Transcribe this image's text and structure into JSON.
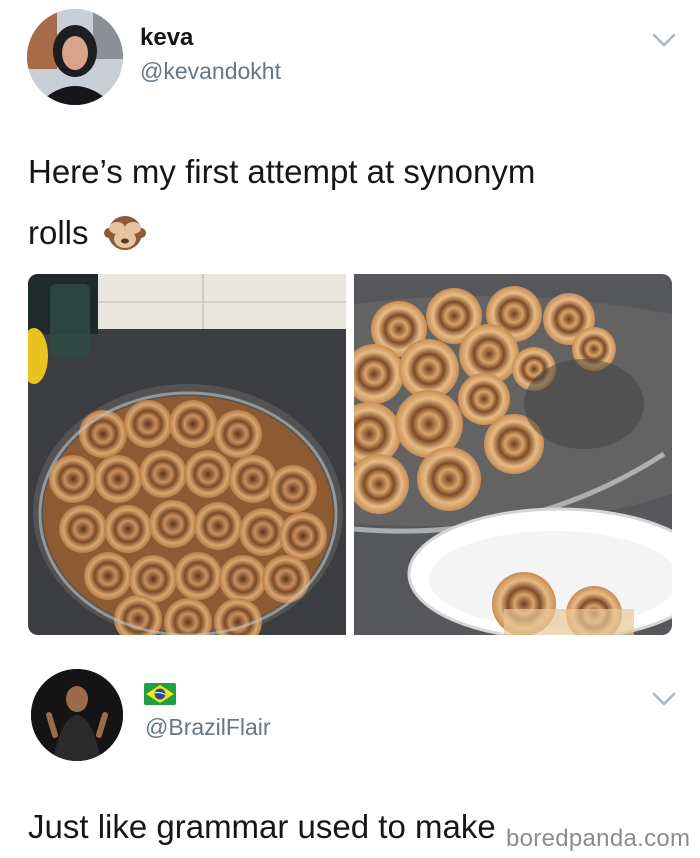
{
  "tweet": {
    "author_name": "keva",
    "author_handle": "@kevandokht",
    "text_line1": "Here’s my first attempt at synonym",
    "text_line2": "rolls",
    "emoji": "see-no-evil-monkey",
    "photos": [
      "cinnamon-rolls-full-pan-photo",
      "cinnamon-rolls-partly-eaten-photo"
    ]
  },
  "reply": {
    "author_flag": "brazil-flag",
    "author_handle": "@BrazilFlair",
    "text": "Just like grammar used to make"
  },
  "watermark": "boredpanda.com",
  "colors": {
    "text": "#14171a",
    "secondary": "#657786",
    "chevron": "#aab8c2"
  }
}
